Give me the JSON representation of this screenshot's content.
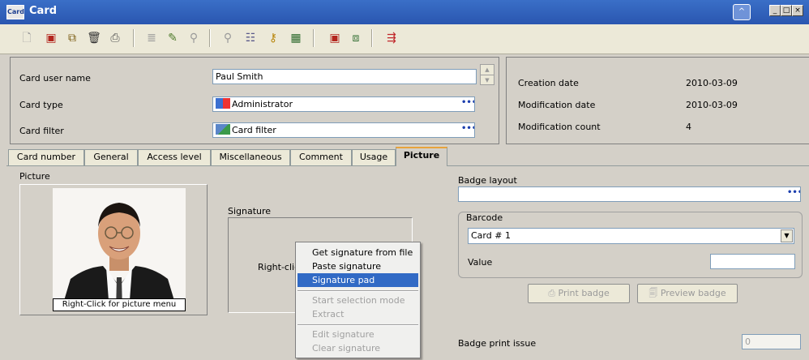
{
  "window": {
    "title": "Card",
    "icon_text": "Card"
  },
  "toolbar": {
    "icons": [
      "new-icon",
      "save-icon",
      "copy-icon",
      "delete-icon",
      "print-icon",
      "list-icon",
      "edit-icon",
      "find-icon",
      "find-next-icon",
      "tree-icon",
      "key-icon",
      "grid-icon",
      "save-alt-icon",
      "save-as-icon",
      "export-icon"
    ]
  },
  "header": {
    "card_user_name_label": "Card user name",
    "card_user_name_value": "Paul Smith",
    "card_type_label": "Card type",
    "card_type_value": "Administrator",
    "card_filter_label": "Card filter",
    "card_filter_value": "Card filter",
    "creation_date_label": "Creation date",
    "creation_date_value": "2010-03-09",
    "modification_date_label": "Modification date",
    "modification_date_value": "2010-03-09",
    "modification_count_label": "Modification count",
    "modification_count_value": "4"
  },
  "tabs": [
    {
      "label": "Card number"
    },
    {
      "label": "General"
    },
    {
      "label": "Access level"
    },
    {
      "label": "Miscellaneous"
    },
    {
      "label": "Comment"
    },
    {
      "label": "Usage"
    },
    {
      "label": "Picture"
    }
  ],
  "picture": {
    "section_label": "Picture",
    "caption": "Right-Click for picture menu",
    "signature_label": "Signature",
    "signature_hint": "Right-clic"
  },
  "context_menu": {
    "items": [
      {
        "label": "Get signature from file"
      },
      {
        "label": "Paste signature"
      },
      {
        "label": "Signature pad"
      },
      {
        "label": "Start selection mode"
      },
      {
        "label": "Extract"
      },
      {
        "label": "Edit signature"
      },
      {
        "label": "Clear signature"
      }
    ]
  },
  "badge": {
    "layout_label": "Badge layout",
    "layout_value": "",
    "barcode_group_label": "Barcode",
    "barcode_selected": "Card # 1",
    "value_label": "Value",
    "value_value": "",
    "print_button": "Print badge",
    "preview_button": "Preview badge",
    "print_issue_label": "Badge print issue",
    "print_issue_value": "0"
  },
  "colors": {
    "titlebar": "#2a56b0",
    "menu_highlight": "#316ac5",
    "active_tab_accent": "#e8a33b"
  }
}
